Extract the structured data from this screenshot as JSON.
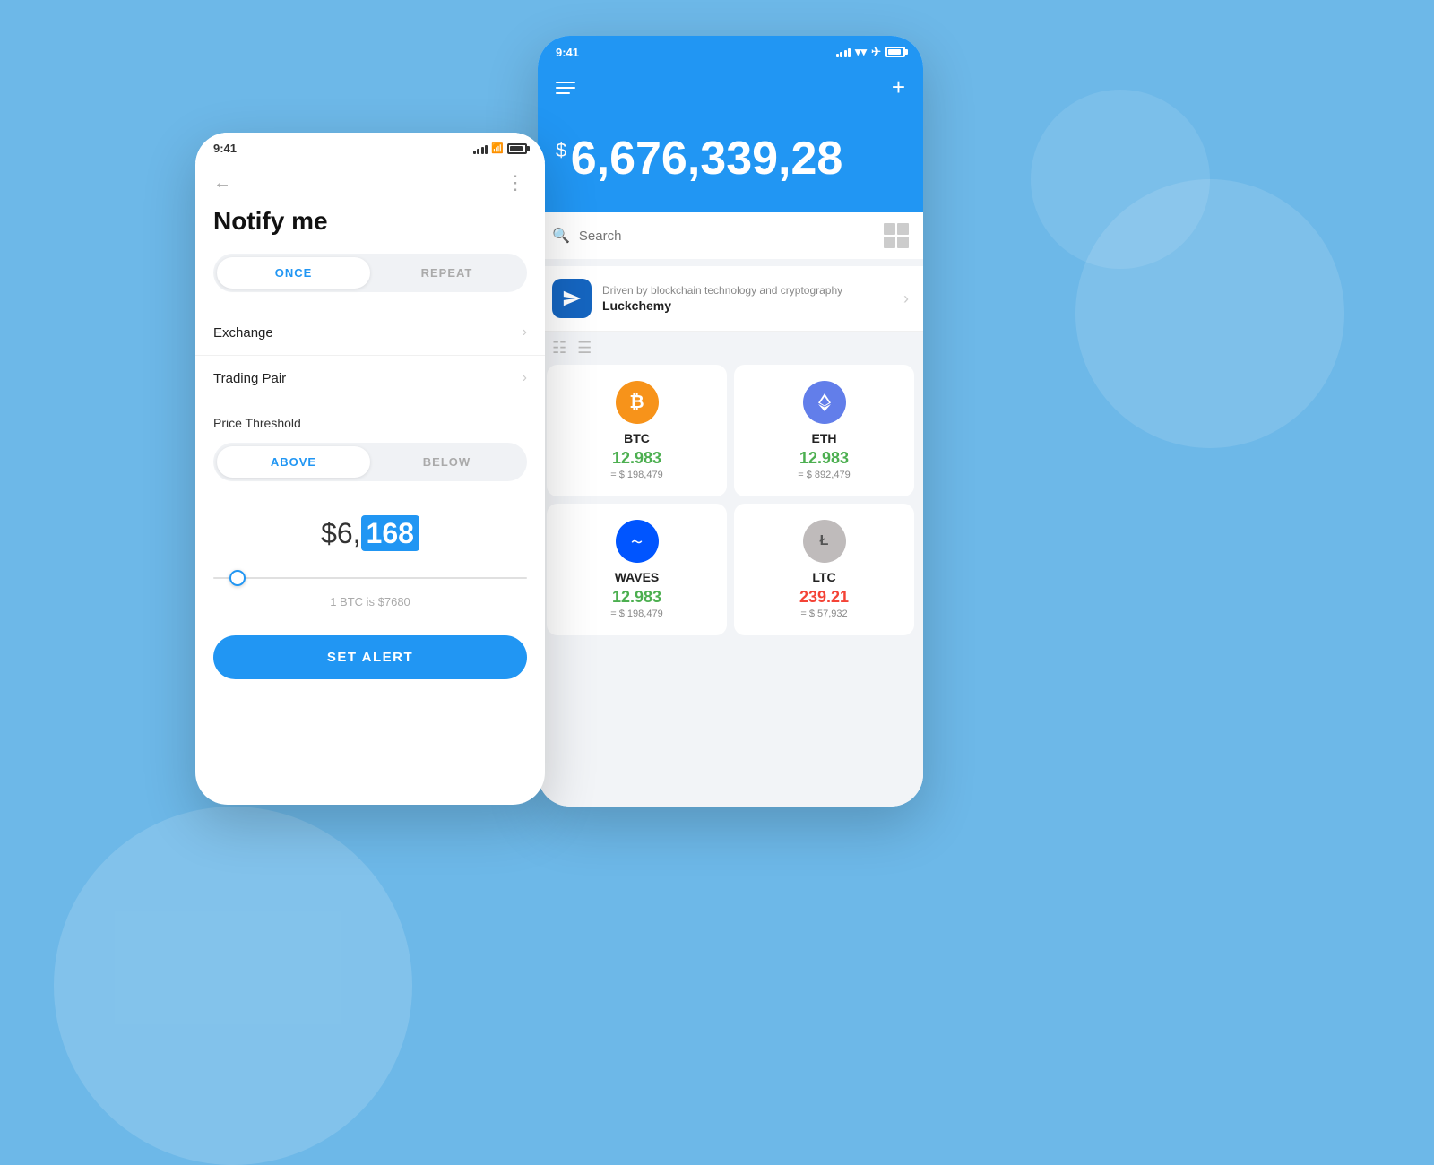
{
  "background": {
    "color": "#6db8e8"
  },
  "phone_back": {
    "status_bar": {
      "time": "9:41",
      "signal": "signal",
      "wifi": "wifi",
      "battery": "battery"
    },
    "portfolio": {
      "currency_symbol": "$",
      "amount": "6,676,339,28"
    },
    "search": {
      "placeholder": "Search"
    },
    "promo": {
      "title": "Luckchemy",
      "subtitle": "Driven by blockchain technology and cryptography"
    },
    "cryptos": [
      {
        "name": "BTC",
        "value": "12.983",
        "usd": "= $ 198,479",
        "change_positive": true
      },
      {
        "name": "ETH",
        "value": "12.983",
        "usd": "= $ 892,479",
        "change_positive": true
      },
      {
        "name": "WAVES",
        "value": "12.983",
        "usd": "= $ 198,479",
        "change_positive": true
      },
      {
        "name": "LTC",
        "value": "239.21",
        "usd": "= $ 57,932",
        "change_positive": false
      }
    ]
  },
  "phone_front": {
    "status_bar": {
      "time": "9:41"
    },
    "nav": {
      "back": "←",
      "more": "⋮"
    },
    "title": "Notify me",
    "notify_toggle": {
      "once": "ONCE",
      "repeat": "REPEAT",
      "active": "once"
    },
    "menu_items": [
      {
        "label": "Exchange",
        "id": "exchange"
      },
      {
        "label": "Trading Pair",
        "id": "trading-pair"
      }
    ],
    "price_threshold": {
      "label": "Price Threshold",
      "above": "ABOVE",
      "below": "BELOW",
      "active": "above"
    },
    "price_value": {
      "prefix": "$6,",
      "highlighted": "168"
    },
    "btc_info": "1 BTC is $7680",
    "set_alert_button": "SET ALERT"
  }
}
